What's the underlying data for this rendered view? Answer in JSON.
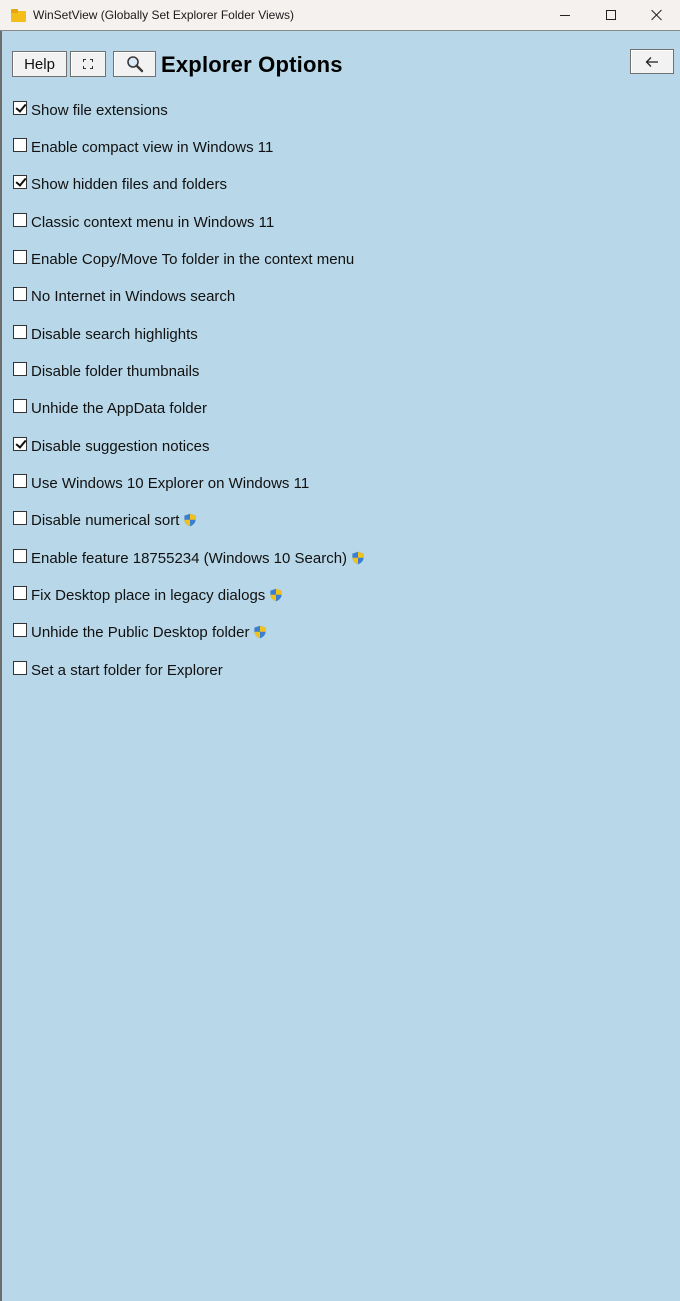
{
  "window": {
    "title": "WinSetView (Globally Set Explorer Folder Views)",
    "minimize_icon": "minimize-icon",
    "maximize_icon": "maximize-icon",
    "close_icon": "close-icon"
  },
  "toolbar": {
    "help_label": "Help",
    "expand_icon": "fullscreen-icon",
    "search_icon": "magnifier-icon",
    "back_icon": "arrow-left-icon",
    "title": "Explorer Options"
  },
  "colors": {
    "background": "#b8d7e8",
    "titlebar": "#f5f1ef",
    "button": "#f2f2f2"
  },
  "options": [
    {
      "label": "Show file extensions",
      "checked": true,
      "admin": false
    },
    {
      "label": "Enable compact view in Windows 11",
      "checked": false,
      "admin": false
    },
    {
      "label": "Show hidden files and folders",
      "checked": true,
      "admin": false
    },
    {
      "label": "Classic context menu in Windows 11",
      "checked": false,
      "admin": false
    },
    {
      "label": "Enable Copy/Move To folder in the context menu",
      "checked": false,
      "admin": false
    },
    {
      "label": "No Internet in Windows search",
      "checked": false,
      "admin": false
    },
    {
      "label": "Disable search highlights",
      "checked": false,
      "admin": false
    },
    {
      "label": "Disable folder thumbnails",
      "checked": false,
      "admin": false
    },
    {
      "label": "Unhide the AppData folder",
      "checked": false,
      "admin": false
    },
    {
      "label": "Disable suggestion notices",
      "checked": true,
      "admin": false
    },
    {
      "label": "Use Windows 10 Explorer on Windows 11",
      "checked": false,
      "admin": false
    },
    {
      "label": "Disable numerical sort",
      "checked": false,
      "admin": true
    },
    {
      "label": "Enable feature 18755234 (Windows 10 Search)",
      "checked": false,
      "admin": true
    },
    {
      "label": "Fix Desktop place in legacy dialogs",
      "checked": false,
      "admin": true
    },
    {
      "label": "Unhide the Public Desktop folder",
      "checked": false,
      "admin": true
    },
    {
      "label": "Set a start folder for Explorer",
      "checked": false,
      "admin": false
    }
  ]
}
